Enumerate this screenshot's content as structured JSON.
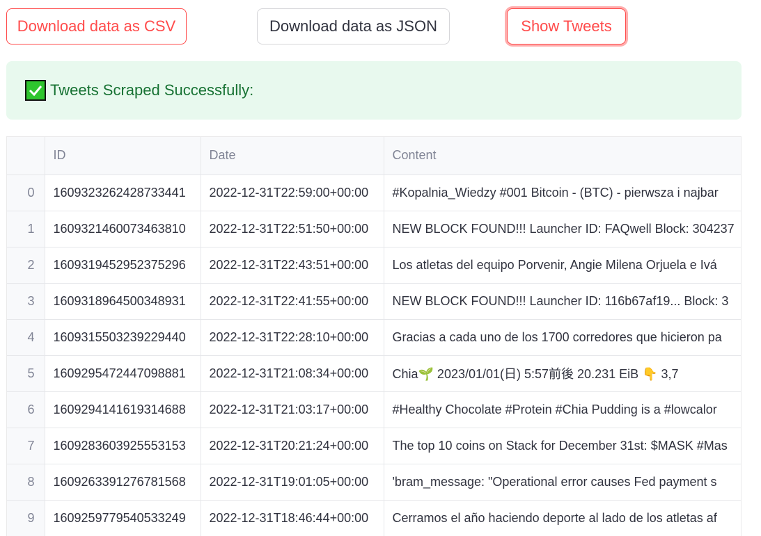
{
  "buttons": {
    "csv": "Download data as CSV",
    "json": "Download data as JSON",
    "show": "Show Tweets"
  },
  "alert": {
    "icon": "check-mark-button-icon",
    "text": "Tweets Scraped Successfully:"
  },
  "table": {
    "columns": [
      "",
      "ID",
      "Date",
      "Content"
    ],
    "rows": [
      {
        "idx": "0",
        "id": "1609323262428733441",
        "date": "2022-12-31T22:59:00+00:00",
        "content": "#Kopalnia_Wiedzy #001  Bitcoin - (BTC) - pierwsza i najbar"
      },
      {
        "idx": "1",
        "id": "1609321460073463810",
        "date": "2022-12-31T22:51:50+00:00",
        "content": "NEW BLOCK FOUND!!! Launcher ID: FAQwell Block: 304237"
      },
      {
        "idx": "2",
        "id": "1609319452952375296",
        "date": "2022-12-31T22:43:51+00:00",
        "content": "Los atletas del equipo Porvenir, Angie Milena Orjuela e Ivá"
      },
      {
        "idx": "3",
        "id": "1609318964500348931",
        "date": "2022-12-31T22:41:55+00:00",
        "content": "NEW BLOCK FOUND!!! Launcher ID: 116b67af19... Block: 3"
      },
      {
        "idx": "4",
        "id": "1609315503239229440",
        "date": "2022-12-31T22:28:10+00:00",
        "content": "Gracias a cada uno de los 1700 corredores que hicieron pa"
      },
      {
        "idx": "5",
        "id": "1609295472447098881",
        "date": "2022-12-31T21:08:34+00:00",
        "content": "Chia🌱 2023/01/01(日) 5:57前後     20.231 EiB    👇     3,7"
      },
      {
        "idx": "6",
        "id": "1609294141619314688",
        "date": "2022-12-31T21:03:17+00:00",
        "content": "#Healthy Chocolate #Protein #Chia Pudding is a #lowcalor"
      },
      {
        "idx": "7",
        "id": "1609283603925553153",
        "date": "2022-12-31T20:21:24+00:00",
        "content": "The top 10 coins on Stack for December 31st:  $MASK #Mas"
      },
      {
        "idx": "8",
        "id": "1609263391276781568",
        "date": "2022-12-31T19:01:05+00:00",
        "content": "'bram_message:  \"Operational error causes Fed payment s"
      },
      {
        "idx": "9",
        "id": "1609259779540533249",
        "date": "2022-12-31T18:46:44+00:00",
        "content": "Cerramos el año haciendo deporte al lado de los atletas af"
      }
    ]
  }
}
